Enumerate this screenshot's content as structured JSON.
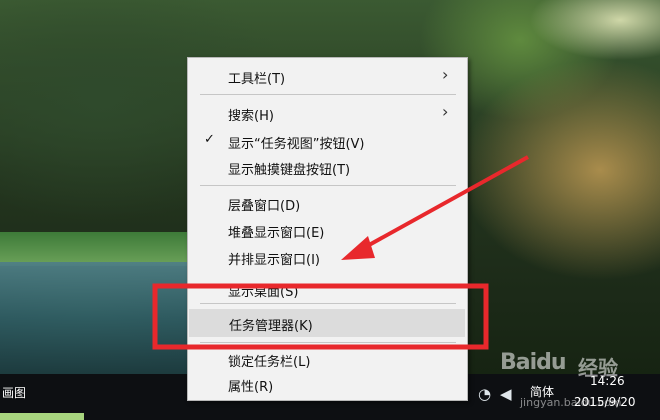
{
  "menu": {
    "items": [
      {
        "label": "工具栏(T)",
        "submenu": true
      },
      {
        "label": "搜索(H)",
        "submenu": true
      },
      {
        "label": "显示“任务视图”按钮(V)",
        "checked": true
      },
      {
        "label": "显示触摸键盘按钮(T)"
      },
      {
        "label": "层叠窗口(D)"
      },
      {
        "label": "堆叠显示窗口(E)"
      },
      {
        "label": "并排显示窗口(I)"
      },
      {
        "label": "显示桌面(S)"
      },
      {
        "label": "任务管理器(K)",
        "highlighted": true
      },
      {
        "label": "锁定任务栏(L)"
      },
      {
        "label": "属性(R)"
      }
    ],
    "check_glyph": "✓",
    "arrow_glyph": "›"
  },
  "taskbar": {
    "left_label": "画图",
    "lang": "简体",
    "time": "14:26",
    "date": "2015/9/20",
    "icons": [
      "network-icon",
      "volume-icon"
    ]
  },
  "watermark": {
    "brand": "Baidu",
    "suffix": "经验",
    "sub": "jingyan.baidu.com"
  },
  "annotations": {
    "arrow_color": "#e8282c",
    "box_color": "#e8282c"
  }
}
